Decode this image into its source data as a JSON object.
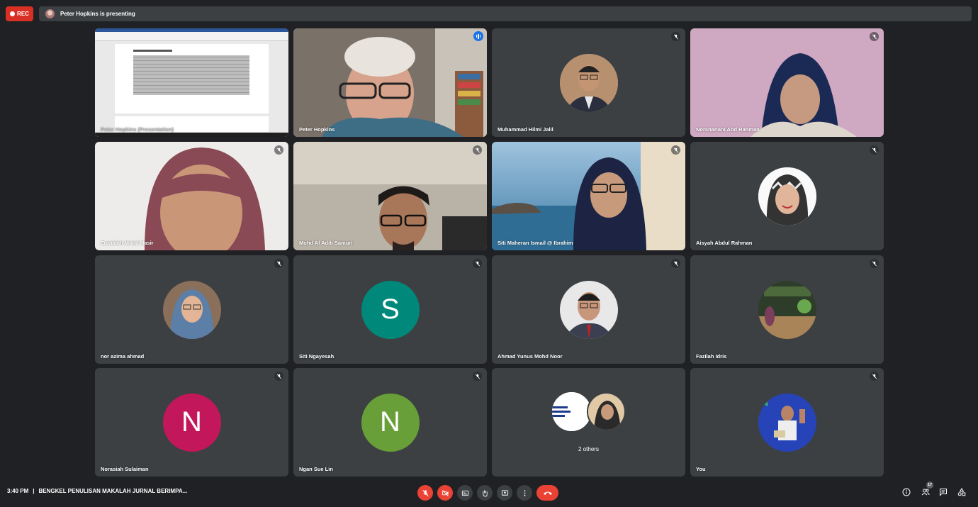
{
  "top": {
    "rec_label": "REC",
    "presenting_text": "Peter Hopkins is presenting"
  },
  "tiles": [
    {
      "name": "Peter Hopkins (Presentation)"
    },
    {
      "name": "Peter Hopkins"
    },
    {
      "name": "Muhammad Hilmi Jalil"
    },
    {
      "name": "Norshariani Abd Rahman"
    },
    {
      "name": "Zuraidah Mohd Nasir"
    },
    {
      "name": "Mohd Al Adib Samuri"
    },
    {
      "name": "Siti Maheran Ismail @ Ibrahim"
    },
    {
      "name": "Aisyah Abdul Rahman"
    },
    {
      "name": "nor azima ahmad"
    },
    {
      "name": "Siti Ngayesah",
      "letter": "S",
      "color": "#00897b"
    },
    {
      "name": "Ahmad Yunus Mohd Noor"
    },
    {
      "name": "Fazilah Idris"
    },
    {
      "name": "Norasiah Sulaiman",
      "letter": "N",
      "color": "#c2185b"
    },
    {
      "name": "Ngan Sue Lin",
      "letter": "N",
      "color": "#689f38"
    },
    {
      "name": "2 others"
    },
    {
      "name": "You"
    }
  ],
  "bottom": {
    "time": "3:40 PM",
    "separator": "|",
    "meeting_title": "BENGKEL PENULISAN MAKALAH JURNAL BERIMPA...",
    "participant_count": "17"
  },
  "colors": {
    "background": "#202124",
    "tile": "#3c4043",
    "red": "#ea4335",
    "accent": "#8ab4f8"
  }
}
